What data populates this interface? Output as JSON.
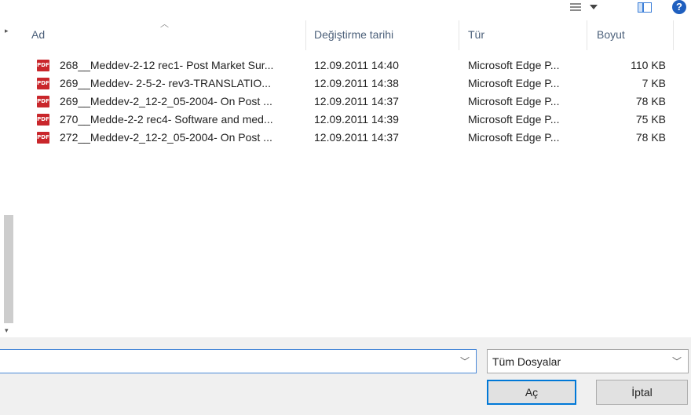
{
  "toolbar": {
    "layout_icon": "details-layout-icon",
    "view_icon": "preview-pane-icon",
    "help_label": "?"
  },
  "columns": {
    "name": "Ad",
    "date": "Değiştirme tarihi",
    "type": "Tür",
    "size": "Boyut"
  },
  "files": [
    {
      "name": "268__Meddev-2-12 rec1- Post Market Sur...",
      "date": "12.09.2011 14:40",
      "type": "Microsoft Edge P...",
      "size": "110 KB",
      "icon": "PDF"
    },
    {
      "name": "269__Meddev- 2-5-2- rev3-TRANSLATIO...",
      "date": "12.09.2011 14:38",
      "type": "Microsoft Edge P...",
      "size": "7 KB",
      "icon": "PDF"
    },
    {
      "name": "269__Meddev-2_12-2_05-2004- On Post ...",
      "date": "12.09.2011 14:37",
      "type": "Microsoft Edge P...",
      "size": "78 KB",
      "icon": "PDF"
    },
    {
      "name": "270__Medde-2-2 rec4- Software and med...",
      "date": "12.09.2011 14:39",
      "type": "Microsoft Edge P...",
      "size": "75 KB",
      "icon": "PDF"
    },
    {
      "name": "272__Meddev-2_12-2_05-2004- On Post ...",
      "date": "12.09.2011 14:37",
      "type": "Microsoft Edge P...",
      "size": "78 KB",
      "icon": "PDF"
    }
  ],
  "filename": {
    "value": ""
  },
  "filetype": {
    "selected": "Tüm Dosyalar"
  },
  "buttons": {
    "open": "Aç",
    "cancel": "İptal"
  },
  "colors": {
    "accent": "#0078d7",
    "pdf": "#c9262b"
  }
}
